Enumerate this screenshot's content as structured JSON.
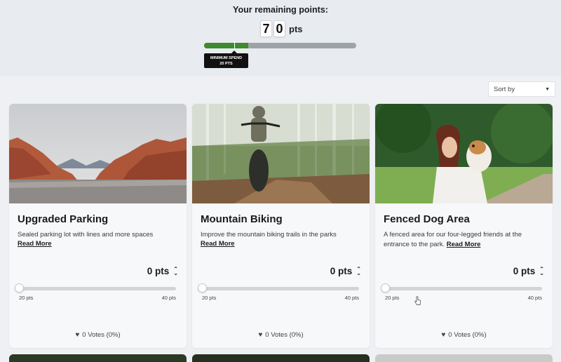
{
  "header": {
    "title": "Your remaining points:",
    "digits": [
      "7",
      "0"
    ],
    "unit": "pts",
    "progress": 0.29,
    "min_spend_line1": "MINIMUM SPEND",
    "min_spend_line2": "20 PTS",
    "colors": {
      "progress_fill": "#3e8a2e",
      "progress_track": "#9ea3a8"
    }
  },
  "sort": {
    "label": "Sort by"
  },
  "cards": [
    {
      "title": "Upgraded Parking",
      "description": "Sealed parking lot with lines and more spaces",
      "read_more": "Read More",
      "points": "0 pts",
      "slider_min": "20 pts",
      "slider_max": "40 pts",
      "votes": "0 Votes (0%)",
      "image": "red-rock-parking-lot"
    },
    {
      "title": "Mountain Biking",
      "description": "Improve the mountain biking trails in the parks",
      "read_more": "Read More",
      "points": "0 pts",
      "slider_min": "20 pts",
      "slider_max": "40 pts",
      "votes": "0 Votes (0%)",
      "image": "forest-mountain-biker"
    },
    {
      "title": "Fenced Dog Area",
      "description": "A fenced area for our four-legged friends at the entrance to the park.",
      "read_more": "Read More",
      "points": "0 pts",
      "slider_min": "20 pts",
      "slider_max": "40 pts",
      "votes": "0 Votes (0%)",
      "image": "woman-with-dog-in-park"
    }
  ]
}
